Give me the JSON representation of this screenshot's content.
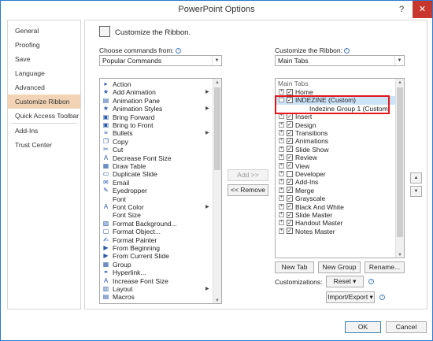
{
  "window": {
    "title": "PowerPoint Options",
    "help_label": "?",
    "close_label": "✕"
  },
  "nav": {
    "items": [
      {
        "label": "General"
      },
      {
        "label": "Proofing"
      },
      {
        "label": "Save"
      },
      {
        "label": "Language"
      },
      {
        "label": "Advanced"
      },
      {
        "label": "Customize Ribbon"
      },
      {
        "label": "Quick Access Toolbar"
      },
      {
        "label": "Add-Ins"
      },
      {
        "label": "Trust Center"
      }
    ],
    "selected": "Customize Ribbon"
  },
  "header": {
    "title": "Customize the Ribbon."
  },
  "left": {
    "label": "Choose commands from:",
    "selected": "Popular Commands",
    "commands": [
      {
        "label": "Action",
        "icon": "action-icon",
        "submenu": false
      },
      {
        "label": "Add Animation",
        "icon": "star-icon",
        "submenu": true
      },
      {
        "label": "Animation Pane",
        "icon": "animation-pane-icon",
        "submenu": false
      },
      {
        "label": "Animation Styles",
        "icon": "star-icon",
        "submenu": true
      },
      {
        "label": "Bring Forward",
        "icon": "bring-forward-icon",
        "submenu": false
      },
      {
        "label": "Bring to Front",
        "icon": "bring-front-icon",
        "submenu": false
      },
      {
        "label": "Bullets",
        "icon": "bullets-icon",
        "submenu": true
      },
      {
        "label": "Copy",
        "icon": "copy-icon",
        "submenu": false
      },
      {
        "label": "Cut",
        "icon": "cut-icon",
        "submenu": false
      },
      {
        "label": "Decrease Font Size",
        "icon": "decrease-font-icon",
        "submenu": false
      },
      {
        "label": "Draw Table",
        "icon": "draw-table-icon",
        "submenu": false
      },
      {
        "label": "Duplicate Slide",
        "icon": "duplicate-slide-icon",
        "submenu": false
      },
      {
        "label": "Email",
        "icon": "email-icon",
        "submenu": false
      },
      {
        "label": "Eyedropper",
        "icon": "eyedropper-icon",
        "submenu": false
      },
      {
        "label": "Font",
        "icon": "font-icon",
        "submenu": false
      },
      {
        "label": "Font Color",
        "icon": "font-color-icon",
        "submenu": true
      },
      {
        "label": "Font Size",
        "icon": "font-size-icon",
        "submenu": false
      },
      {
        "label": "Format Background...",
        "icon": "format-background-icon",
        "submenu": false
      },
      {
        "label": "Format Object...",
        "icon": "format-object-icon",
        "submenu": false
      },
      {
        "label": "Format Painter",
        "icon": "format-painter-icon",
        "submenu": false
      },
      {
        "label": "From Beginning",
        "icon": "from-beginning-icon",
        "submenu": false
      },
      {
        "label": "From Current Slide",
        "icon": "from-current-icon",
        "submenu": false
      },
      {
        "label": "Group",
        "icon": "group-icon",
        "submenu": false
      },
      {
        "label": "Hyperlink...",
        "icon": "hyperlink-icon",
        "submenu": false
      },
      {
        "label": "Increase Font Size",
        "icon": "increase-font-icon",
        "submenu": false
      },
      {
        "label": "Layout",
        "icon": "layout-icon",
        "submenu": true
      },
      {
        "label": "Macros",
        "icon": "macros-icon",
        "submenu": false
      }
    ]
  },
  "middle": {
    "add_label": "Add >>",
    "remove_label": "<< Remove"
  },
  "right": {
    "label": "Customize the Ribbon:",
    "selected": "Main Tabs",
    "header": "Main Tabs",
    "tabs": [
      {
        "label": "Home",
        "expander": "+",
        "checked": true,
        "indent": 0
      },
      {
        "label": "INDEZINE (Custom)",
        "expander": "−",
        "checked": true,
        "indent": 0,
        "selected": true
      },
      {
        "label": "Indezine Group 1 (Custom)",
        "expander": "",
        "checked": false,
        "indent": 1
      },
      {
        "label": "Insert",
        "expander": "+",
        "checked": true,
        "indent": 0
      },
      {
        "label": "Design",
        "expander": "+",
        "checked": true,
        "indent": 0
      },
      {
        "label": "Transitions",
        "expander": "+",
        "checked": true,
        "indent": 0
      },
      {
        "label": "Animations",
        "expander": "+",
        "checked": true,
        "indent": 0
      },
      {
        "label": "Slide Show",
        "expander": "+",
        "checked": true,
        "indent": 0
      },
      {
        "label": "Review",
        "expander": "+",
        "checked": true,
        "indent": 0
      },
      {
        "label": "View",
        "expander": "+",
        "checked": true,
        "indent": 0
      },
      {
        "label": "Developer",
        "expander": "+",
        "checked": false,
        "indent": 0
      },
      {
        "label": "Add-Ins",
        "expander": "+",
        "checked": true,
        "indent": 0
      },
      {
        "label": "Merge",
        "expander": "+",
        "checked": true,
        "indent": 0
      },
      {
        "label": "Grayscale",
        "expander": "+",
        "checked": true,
        "indent": 0
      },
      {
        "label": "Black And White",
        "expander": "+",
        "checked": true,
        "indent": 0
      },
      {
        "label": "Slide Master",
        "expander": "+",
        "checked": true,
        "indent": 0
      },
      {
        "label": "Handout Master",
        "expander": "+",
        "checked": true,
        "indent": 0
      },
      {
        "label": "Notes Master",
        "expander": "+",
        "checked": true,
        "indent": 0
      }
    ],
    "new_tab_label": "New Tab",
    "new_group_label": "New Group",
    "rename_label": "Rename...",
    "customizations_label": "Customizations:",
    "reset_label": "Reset ▾",
    "import_export_label": "Import/Export ▾",
    "move_up": "▲",
    "move_down": "▼"
  },
  "footer": {
    "ok_label": "OK",
    "cancel_label": "Cancel"
  },
  "colors": {
    "nav_selected": "#f2d3b5",
    "highlight_box": "#e3171c",
    "tree_selected": "#cce4f7"
  }
}
